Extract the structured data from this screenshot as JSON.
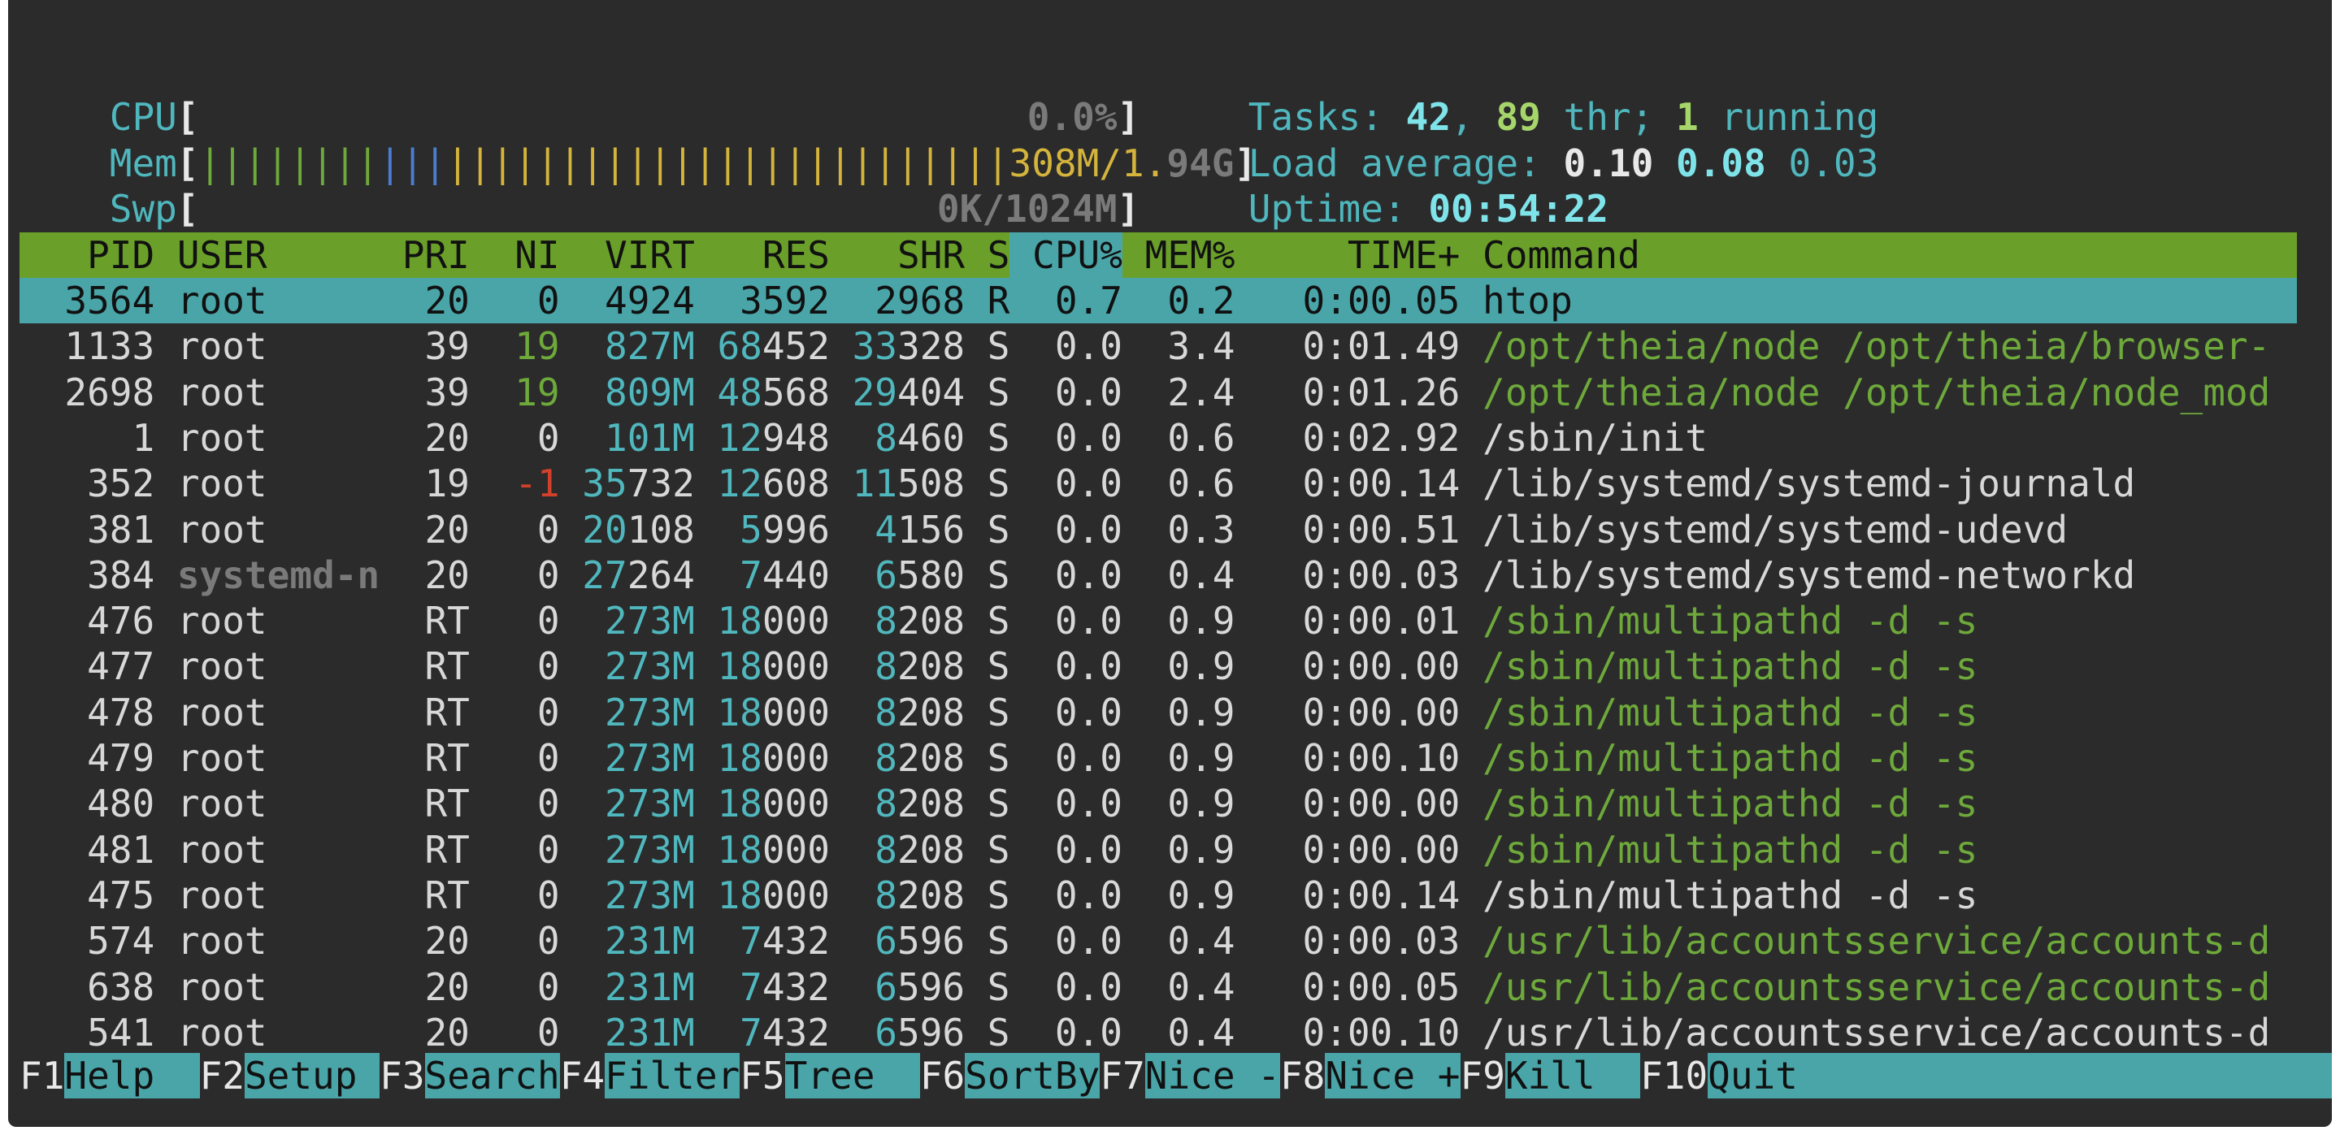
{
  "meters": {
    "cpu": {
      "label": "CPU",
      "text": "0.0%"
    },
    "mem": {
      "label": "Mem",
      "bars_green": "||||||||",
      "bars_blue": "|||",
      "bars_yellow": "|||||||||||||||||||||||||",
      "text_used": "308M/1.",
      "text_total": "94G"
    },
    "swp": {
      "label": "Swp",
      "text": "0K/1024M"
    }
  },
  "info": {
    "tasks_label": "Tasks:",
    "tasks": "42",
    "threads": "89",
    "thr_label": "thr;",
    "running": "1",
    "running_label": "running",
    "load_label": "Load average:",
    "load1": "0.10",
    "load5": "0.08",
    "load15": "0.03",
    "uptime_label": "Uptime:",
    "uptime": "00:54:22"
  },
  "columns": [
    "PID",
    "USER",
    "PRI",
    "NI",
    "VIRT",
    "RES",
    "SHR",
    "S",
    "CPU%",
    "MEM%",
    "TIME+",
    "Command"
  ],
  "processes": [
    {
      "pid": "3564",
      "user": "root",
      "pri": "20",
      "ni": "0",
      "virt": "4924",
      "res": "3592",
      "shr": "2968",
      "s": "R",
      "cpu": "0.7",
      "mem": "0.2",
      "time": "0:00.05",
      "cmd": "htop"
    },
    {
      "pid": "1133",
      "user": "root",
      "pri": "39",
      "ni": "19",
      "virt": "827M",
      "res": "68452",
      "shr": "33328",
      "s": "S",
      "cpu": "0.0",
      "mem": "3.4",
      "time": "0:01.49",
      "cmd": "/opt/theia/node /opt/theia/browser-"
    },
    {
      "pid": "2698",
      "user": "root",
      "pri": "39",
      "ni": "19",
      "virt": "809M",
      "res": "48568",
      "shr": "29404",
      "s": "S",
      "cpu": "0.0",
      "mem": "2.4",
      "time": "0:01.26",
      "cmd": "/opt/theia/node /opt/theia/node_mod"
    },
    {
      "pid": "1",
      "user": "root",
      "pri": "20",
      "ni": "0",
      "virt": "101M",
      "res": "12948",
      "shr": "8460",
      "s": "S",
      "cpu": "0.0",
      "mem": "0.6",
      "time": "0:02.92",
      "cmd": "/sbin/init"
    },
    {
      "pid": "352",
      "user": "root",
      "pri": "19",
      "ni": "-1",
      "virt": "35732",
      "res": "12608",
      "shr": "11508",
      "s": "S",
      "cpu": "0.0",
      "mem": "0.6",
      "time": "0:00.14",
      "cmd": "/lib/systemd/systemd-journald"
    },
    {
      "pid": "381",
      "user": "root",
      "pri": "20",
      "ni": "0",
      "virt": "20108",
      "res": "5996",
      "shr": "4156",
      "s": "S",
      "cpu": "0.0",
      "mem": "0.3",
      "time": "0:00.51",
      "cmd": "/lib/systemd/systemd-udevd"
    },
    {
      "pid": "384",
      "user": "systemd-n",
      "pri": "20",
      "ni": "0",
      "virt": "27264",
      "res": "7440",
      "shr": "6580",
      "s": "S",
      "cpu": "0.0",
      "mem": "0.4",
      "time": "0:00.03",
      "cmd": "/lib/systemd/systemd-networkd"
    },
    {
      "pid": "476",
      "user": "root",
      "pri": "RT",
      "ni": "0",
      "virt": "273M",
      "res": "18000",
      "shr": "8208",
      "s": "S",
      "cpu": "0.0",
      "mem": "0.9",
      "time": "0:00.01",
      "cmd": "/sbin/multipathd -d -s"
    },
    {
      "pid": "477",
      "user": "root",
      "pri": "RT",
      "ni": "0",
      "virt": "273M",
      "res": "18000",
      "shr": "8208",
      "s": "S",
      "cpu": "0.0",
      "mem": "0.9",
      "time": "0:00.00",
      "cmd": "/sbin/multipathd -d -s"
    },
    {
      "pid": "478",
      "user": "root",
      "pri": "RT",
      "ni": "0",
      "virt": "273M",
      "res": "18000",
      "shr": "8208",
      "s": "S",
      "cpu": "0.0",
      "mem": "0.9",
      "time": "0:00.00",
      "cmd": "/sbin/multipathd -d -s"
    },
    {
      "pid": "479",
      "user": "root",
      "pri": "RT",
      "ni": "0",
      "virt": "273M",
      "res": "18000",
      "shr": "8208",
      "s": "S",
      "cpu": "0.0",
      "mem": "0.9",
      "time": "0:00.10",
      "cmd": "/sbin/multipathd -d -s"
    },
    {
      "pid": "480",
      "user": "root",
      "pri": "RT",
      "ni": "0",
      "virt": "273M",
      "res": "18000",
      "shr": "8208",
      "s": "S",
      "cpu": "0.0",
      "mem": "0.9",
      "time": "0:00.00",
      "cmd": "/sbin/multipathd -d -s"
    },
    {
      "pid": "481",
      "user": "root",
      "pri": "RT",
      "ni": "0",
      "virt": "273M",
      "res": "18000",
      "shr": "8208",
      "s": "S",
      "cpu": "0.0",
      "mem": "0.9",
      "time": "0:00.00",
      "cmd": "/sbin/multipathd -d -s"
    },
    {
      "pid": "475",
      "user": "root",
      "pri": "RT",
      "ni": "0",
      "virt": "273M",
      "res": "18000",
      "shr": "8208",
      "s": "S",
      "cpu": "0.0",
      "mem": "0.9",
      "time": "0:00.14",
      "cmd": "/sbin/multipathd -d -s"
    },
    {
      "pid": "574",
      "user": "root",
      "pri": "20",
      "ni": "0",
      "virt": "231M",
      "res": "7432",
      "shr": "6596",
      "s": "S",
      "cpu": "0.0",
      "mem": "0.4",
      "time": "0:00.03",
      "cmd": "/usr/lib/accountsservice/accounts-d"
    },
    {
      "pid": "638",
      "user": "root",
      "pri": "20",
      "ni": "0",
      "virt": "231M",
      "res": "7432",
      "shr": "6596",
      "s": "S",
      "cpu": "0.0",
      "mem": "0.4",
      "time": "0:00.05",
      "cmd": "/usr/lib/accountsservice/accounts-d"
    },
    {
      "pid": "541",
      "user": "root",
      "pri": "20",
      "ni": "0",
      "virt": "231M",
      "res": "7432",
      "shr": "6596",
      "s": "S",
      "cpu": "0.0",
      "mem": "0.4",
      "time": "0:00.10",
      "cmd": "/usr/lib/accountsservice/accounts-d"
    }
  ],
  "thread_rows": [
    "1133",
    "2698",
    "476",
    "477",
    "478",
    "479",
    "480",
    "481",
    "574",
    "638"
  ],
  "selected_pid": "3564",
  "sort_column": "CPU%",
  "footer": [
    {
      "key": "F1",
      "label": "Help  "
    },
    {
      "key": "F2",
      "label": "Setup "
    },
    {
      "key": "F3",
      "label": "Search"
    },
    {
      "key": "F4",
      "label": "Filter"
    },
    {
      "key": "F5",
      "label": "Tree  "
    },
    {
      "key": "F6",
      "label": "SortBy"
    },
    {
      "key": "F7",
      "label": "Nice -"
    },
    {
      "key": "F8",
      "label": "Nice +"
    },
    {
      "key": "F9",
      "label": "Kill  "
    },
    {
      "key": "F10",
      "label": "Quit"
    }
  ],
  "colors": {
    "background": "#2b2b2b",
    "header_bar": "#6aa02a",
    "selection": "#4aa5a9",
    "cyan": "#4fb7bd",
    "green": "#6ea93b",
    "red": "#d2402a"
  }
}
